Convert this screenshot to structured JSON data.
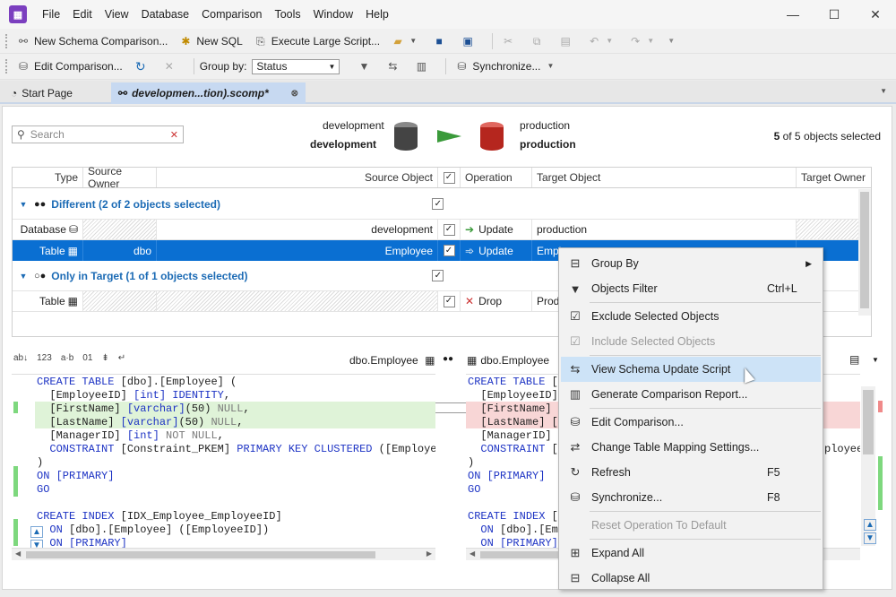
{
  "menu": [
    "File",
    "Edit",
    "View",
    "Database",
    "Comparison",
    "Tools",
    "Window",
    "Help"
  ],
  "toolbar1": {
    "new_schema": "New Schema Comparison...",
    "new_sql": "New SQL",
    "execute": "Execute Large Script..."
  },
  "toolbar2": {
    "edit": "Edit Comparison...",
    "groupby_label": "Group by:",
    "groupby_value": "Status",
    "sync": "Synchronize..."
  },
  "tabs": {
    "start": "Start Page",
    "doc": "developmen...tion).scomp*"
  },
  "header": {
    "search_placeholder": "Search",
    "source_small": "development",
    "source_bold": "development",
    "target_small": "production",
    "target_bold": "production",
    "sel_count": "5",
    "sel_rest": "of 5 objects selected"
  },
  "grid": {
    "cols": [
      "Type",
      "Source Owner",
      "Source Object",
      "Operation",
      "Target Object",
      "Target Owner"
    ],
    "group1": "Different (2 of 2 objects selected)",
    "row1": {
      "type": "Database",
      "obj": "development",
      "op": "Update",
      "target": "production"
    },
    "row2": {
      "type": "Table",
      "owner": "dbo",
      "obj": "Employee",
      "op": "Update",
      "target": "Empl"
    },
    "group2": "Only in Target (1 of 1 objects selected)",
    "row3": {
      "type": "Table",
      "op": "Drop",
      "target": "Produ"
    }
  },
  "diff": {
    "left_title": "dbo.Employee",
    "right_title": "dbo.Employee",
    "left_icon_labels": [
      "a·b"
    ],
    "left_lines": [
      "CREATE TABLE [dbo].[Employee] (",
      "  [EmployeeID] [int] IDENTITY,",
      "  [FirstName] [varchar](50) NULL,",
      "  [LastName] [varchar](50) NULL,",
      "  [ManagerID] [int] NOT NULL,",
      "  CONSTRAINT [Constraint_PKEM] PRIMARY KEY CLUSTERED ([Employee",
      ")",
      "ON [PRIMARY]",
      "GO",
      "",
      "CREATE INDEX [IDX_Employee_EmployeeID]",
      "  ON [dbo].[Employee] ([EmployeeID])",
      "  ON [PRIMARY]"
    ],
    "right_lines": [
      "CREATE TABLE [d",
      "  [EmployeeID]",
      "  [FirstName] [",
      "  [LastName] [r",
      "  [ManagerID] [",
      "  CONSTRAINT [C",
      ")",
      "ON [PRIMARY]",
      "GO",
      "",
      "CREATE INDEX [I",
      "  ON [dbo].[Emp",
      "  ON [PRIMARY]"
    ],
    "right_tail": "ployee"
  },
  "context_menu": [
    {
      "label": "Group By",
      "shortcut": "",
      "icon": "group-icon",
      "submenu": true
    },
    {
      "label": "Objects Filter",
      "shortcut": "Ctrl+L",
      "icon": "filter-icon"
    },
    {
      "sep": true
    },
    {
      "label": "Exclude Selected Objects",
      "shortcut": "",
      "icon": "exclude-icon"
    },
    {
      "label": "Include Selected Objects",
      "shortcut": "",
      "icon": "include-icon",
      "disabled": true
    },
    {
      "sep": true
    },
    {
      "label": "View Schema Update Script",
      "shortcut": "",
      "icon": "script-icon",
      "hover": true
    },
    {
      "label": "Generate Comparison Report...",
      "shortcut": "",
      "icon": "report-icon"
    },
    {
      "sep": true
    },
    {
      "label": "Edit Comparison...",
      "shortcut": "",
      "icon": "edit-icon"
    },
    {
      "label": "Change Table Mapping Settings...",
      "shortcut": "",
      "icon": "mapping-icon"
    },
    {
      "label": "Refresh",
      "shortcut": "F5",
      "icon": "refresh-icon"
    },
    {
      "label": "Synchronize...",
      "shortcut": "F8",
      "icon": "sync-icon"
    },
    {
      "sep": true
    },
    {
      "label": "Reset Operation To Default",
      "shortcut": "",
      "icon": "reset-icon",
      "disabled": true
    },
    {
      "sep": true
    },
    {
      "label": "Expand All",
      "shortcut": "",
      "icon": "expand-icon"
    },
    {
      "label": "Collapse All",
      "shortcut": "",
      "icon": "collapse-icon"
    }
  ],
  "colors": {
    "selection": "#0a6fd2",
    "accent": "#7b3fbf",
    "source_db": "#444444",
    "target_db": "#b5261e",
    "arrow": "#3a9a3a"
  }
}
